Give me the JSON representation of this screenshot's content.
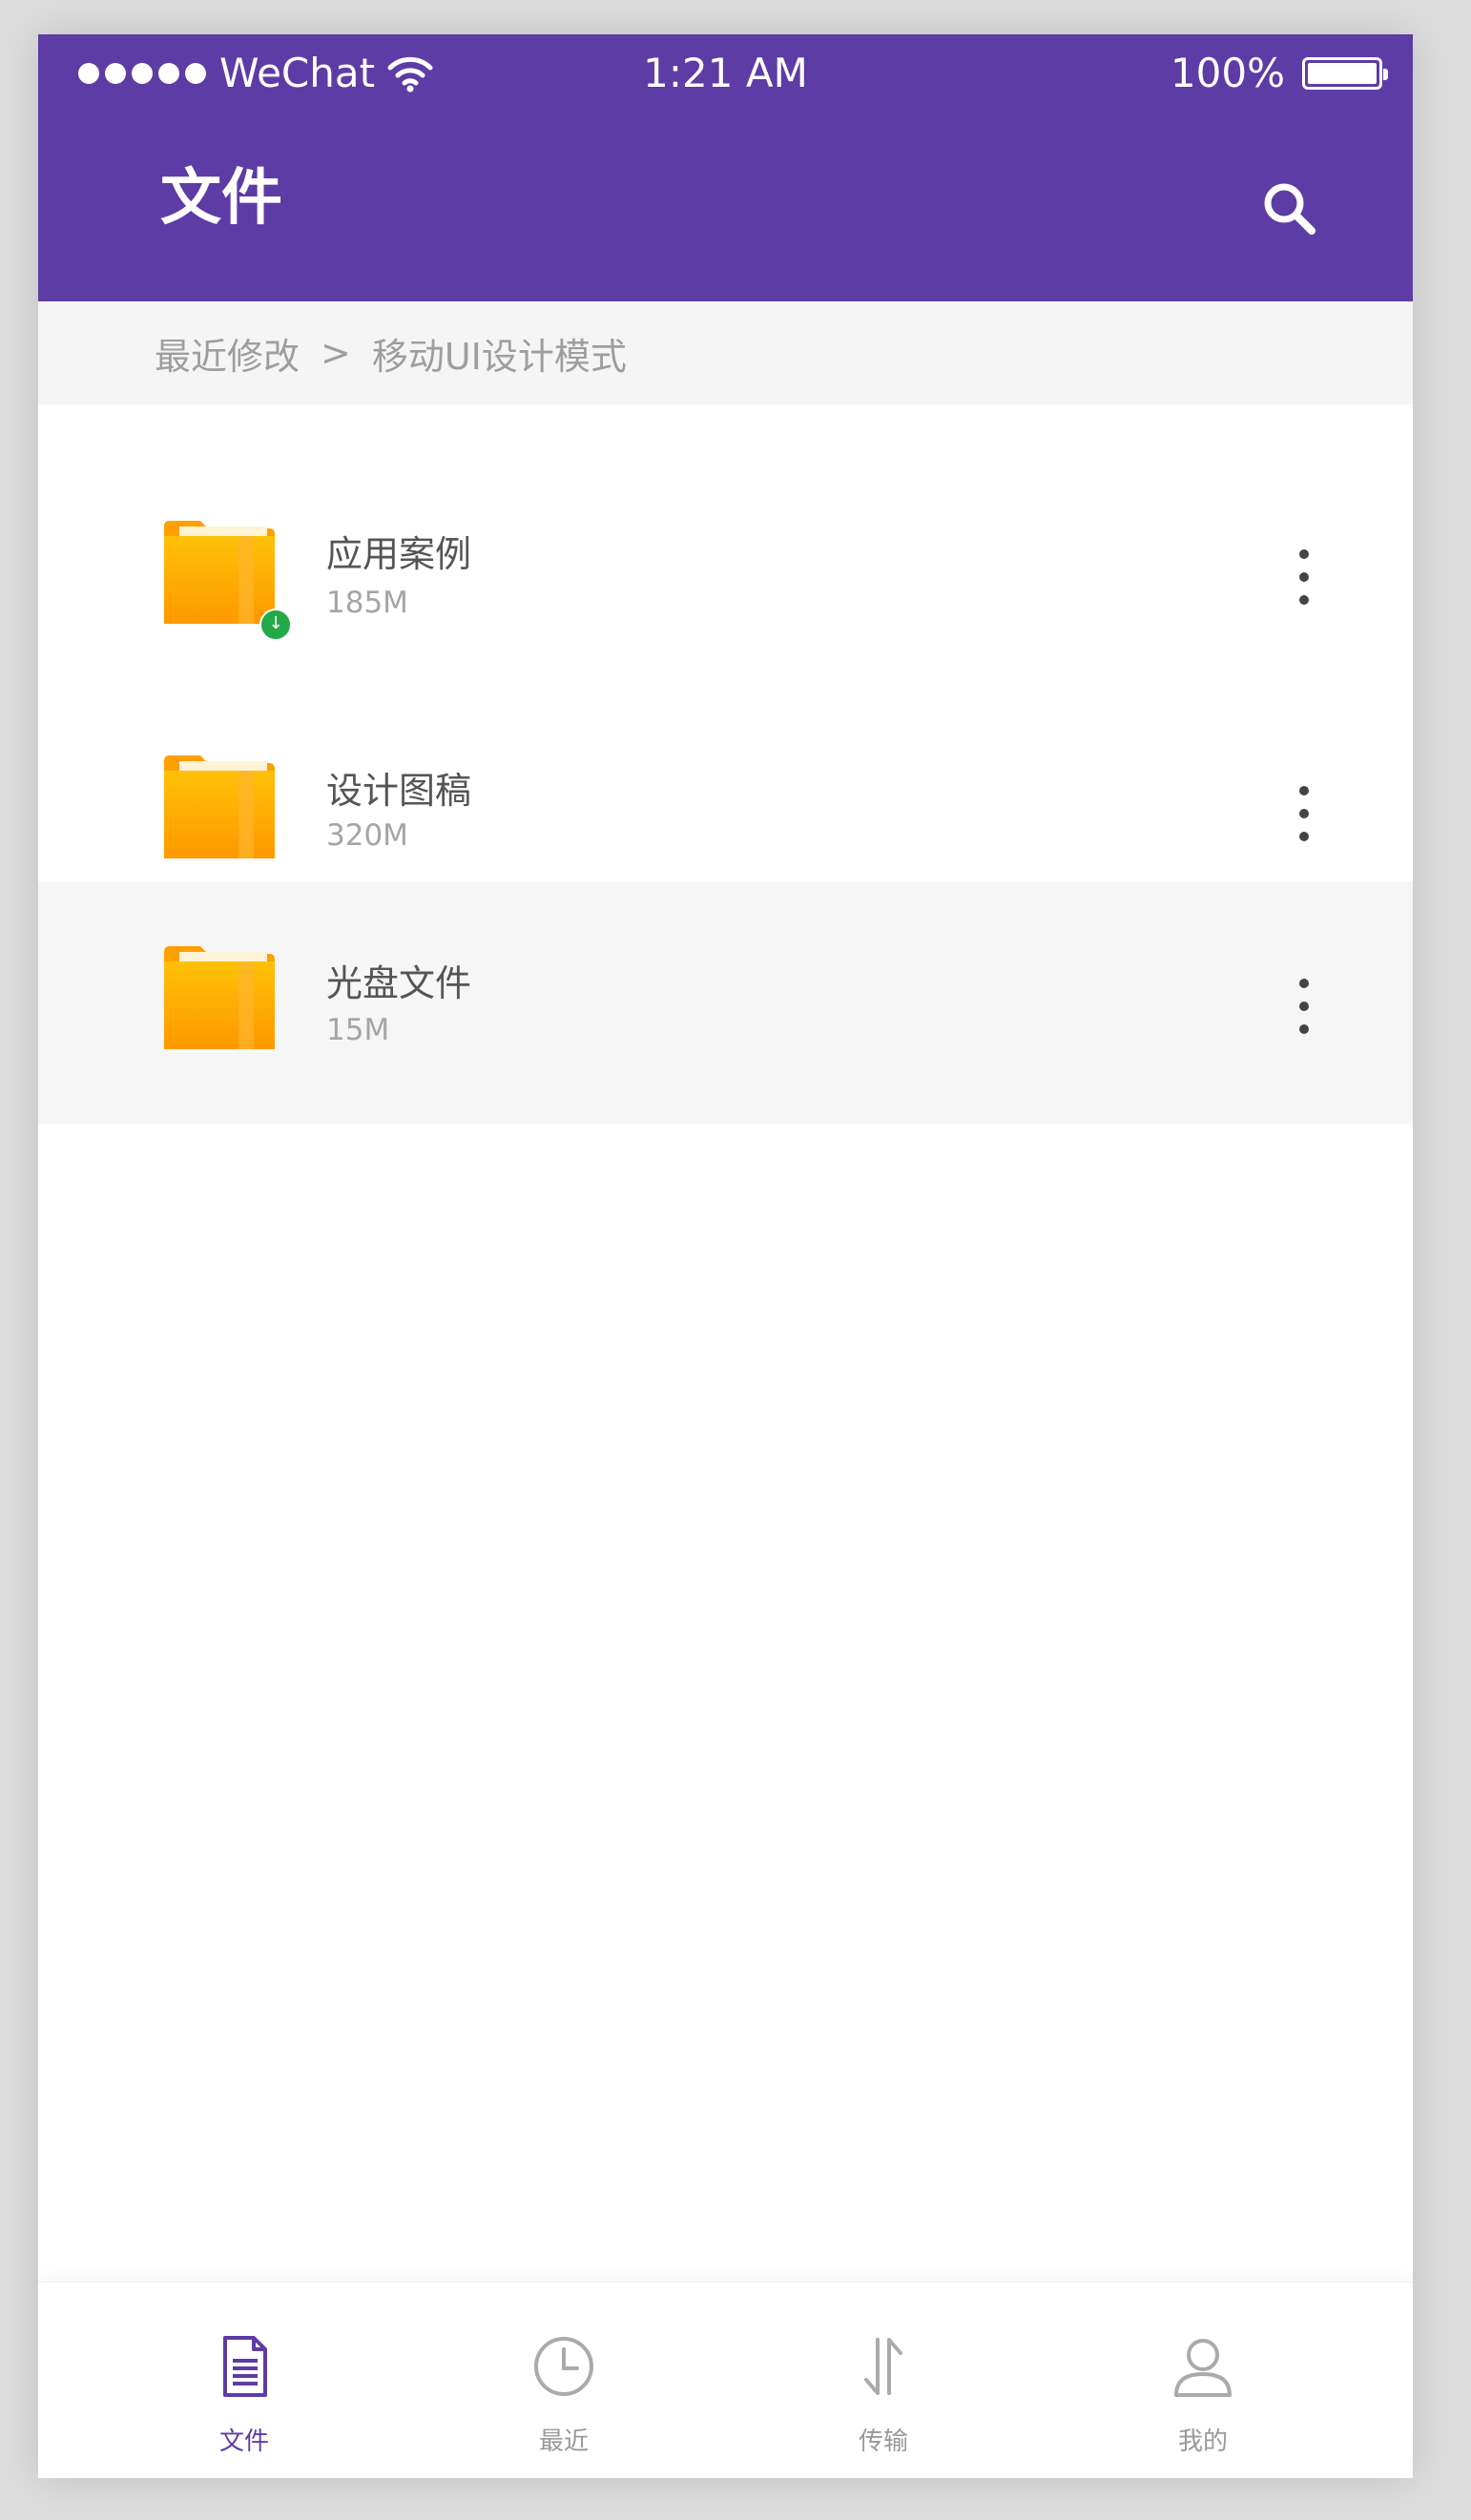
{
  "status_bar": {
    "carrier": "WeChat",
    "time": "1:21 AM",
    "battery": "100%"
  },
  "header": {
    "title": "文件"
  },
  "breadcrumb": {
    "parent": "最近修改",
    "separator": ">",
    "current": "移动UI设计模式"
  },
  "files": [
    {
      "name": "应用案例",
      "size": "185M"
    },
    {
      "name": "设计图稿",
      "size": "320M"
    },
    {
      "name": "光盘文件",
      "size": "15M"
    }
  ],
  "tabbar": {
    "tabs": [
      {
        "label": "文件",
        "icon": "document-icon"
      },
      {
        "label": "最近",
        "icon": "clock-icon"
      },
      {
        "label": "传输",
        "icon": "transfer-icon"
      },
      {
        "label": "我的",
        "icon": "user-icon"
      }
    ],
    "active_index": 0
  },
  "colors": {
    "primary": "#5d3ca5",
    "folder": "#ffa000",
    "download_badge": "#22a94a"
  }
}
